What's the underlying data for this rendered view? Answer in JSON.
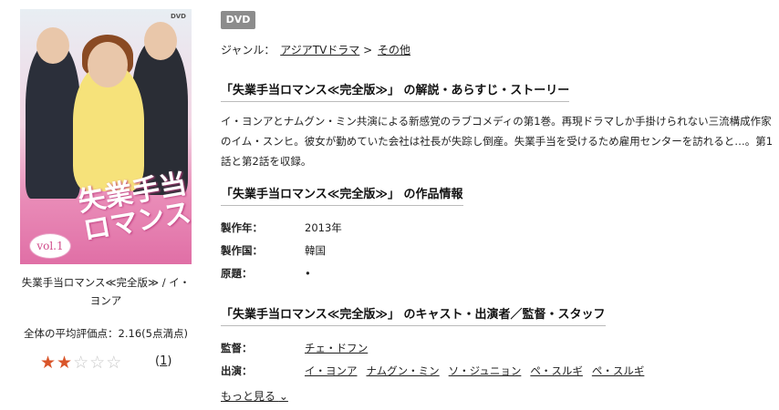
{
  "cover": {
    "dvd_logo": "DVD",
    "title_art": "失業手当ロマンス",
    "volume_art": "vol.1"
  },
  "product": {
    "name": "失業手当ロマンス≪完全版≫ / イ・ヨンア",
    "avg_rating_text": "全体の平均評価点：2.16(5点満点)",
    "rating_value": 2.16,
    "rating_max": 5,
    "review_count": "1"
  },
  "badge": "DVD",
  "genre": {
    "label": "ジャンル：",
    "items": [
      "アジアTVドラマ",
      "その他"
    ],
    "separator": ">"
  },
  "synopsis_section": {
    "heading": "「失業手当ロマンス≪完全版≫」 の解説・あらすじ・ストーリー",
    "text": "イ・ヨンアとナムグン・ミン共演による新感覚のラブコメディの第1巻。再現ドラマしか手掛けられない三流構成作家のイム・スンヒ。彼女が勤めていた会社は社長が失踪し倒産。失業手当を受けるため雇用センターを訪れると…。第1話と第2話を収録。"
  },
  "info_section": {
    "heading": "「失業手当ロマンス≪完全版≫」 の作品情報",
    "rows": [
      {
        "k": "製作年：",
        "v": "2013年"
      },
      {
        "k": "製作国：",
        "v": "韓国"
      },
      {
        "k": "原題：",
        "v": "•"
      }
    ]
  },
  "cast_section": {
    "heading": "「失業手当ロマンス≪完全版≫」 のキャスト・出演者／監督・スタッフ",
    "director_label": "監督：",
    "director": "チェ・ドフン",
    "cast_label": "出演：",
    "cast": [
      "イ・ヨンア",
      "ナムグン・ミン",
      "ソ・ジュニョン",
      "ペ・スルギ",
      "ペ・スルギ"
    ],
    "more": "もっと見る"
  },
  "colors": {
    "star_on": "#d9552a",
    "star_off": "#c8c8c8",
    "badge_bg": "#8c8c8c"
  }
}
